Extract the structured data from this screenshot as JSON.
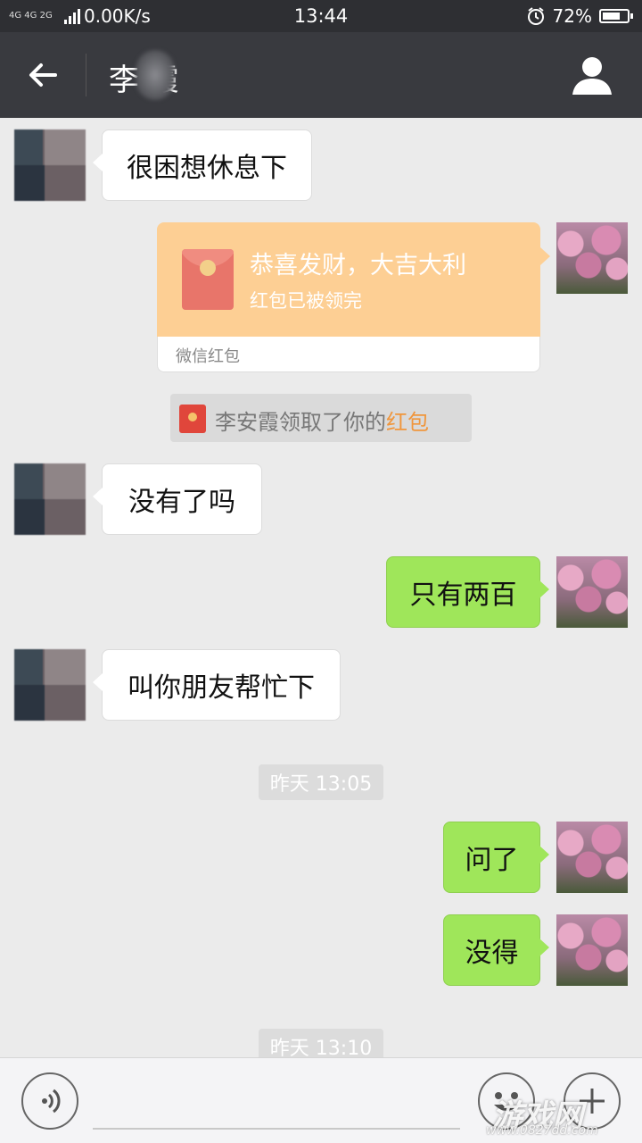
{
  "status_bar": {
    "network_types": "4G 4G 2G",
    "speed": "0.00K/s",
    "time": "13:44",
    "battery_percent": "72%",
    "battery_level": 0.72,
    "alarm_icon": "alarm-clock-icon"
  },
  "header": {
    "title": "李 霞",
    "back_icon": "arrow-left-icon",
    "profile_icon": "person-icon"
  },
  "messages": [
    {
      "side": "left",
      "text": "很困想休息下"
    },
    {
      "side": "right",
      "type": "red_packet",
      "title": "恭喜发财，大吉大利",
      "status": "红包已被领完",
      "footer": "微信红包"
    },
    {
      "type": "system",
      "text_prefix": "李安霞领取了你的",
      "text_highlight": "红包"
    },
    {
      "side": "left",
      "text": "没有了吗"
    },
    {
      "side": "right",
      "text": "只有两百"
    },
    {
      "side": "left",
      "text": "叫你朋友帮忙下"
    },
    {
      "type": "time",
      "text": "昨天 13:05"
    },
    {
      "side": "right",
      "text": "问了"
    },
    {
      "side": "right",
      "text": "没得"
    },
    {
      "type": "time",
      "text": "昨天 13:10"
    }
  ],
  "input_bar": {
    "voice_icon": "voice-icon",
    "emoji_icon": "smiley-icon",
    "plus_icon": "plus-icon"
  },
  "watermark": {
    "text": "游戏网",
    "url": "www.0827dd.com"
  },
  "colors": {
    "title_bar": "#393a3f",
    "status_bar": "#2e2f33",
    "chat_bg": "#ebebeb",
    "sent_bubble": "#9fe65a",
    "red_packet": "#fdcf94",
    "highlight": "#f0963c"
  }
}
